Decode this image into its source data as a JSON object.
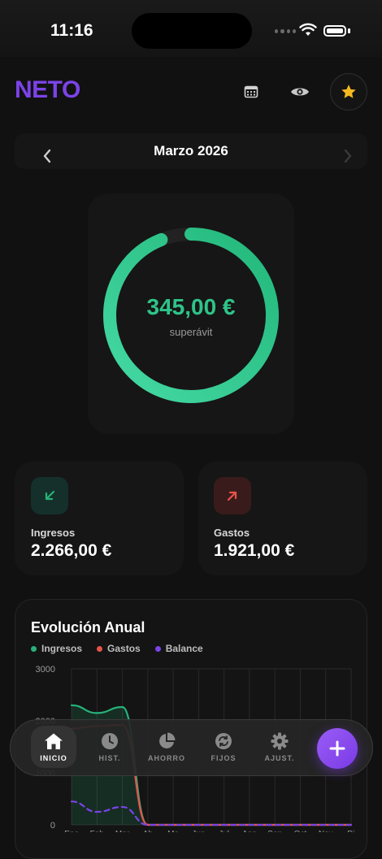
{
  "status_bar": {
    "time": "11:16"
  },
  "header": {
    "logo": "NETO",
    "icons": [
      "calendar-icon",
      "eye-icon",
      "star-icon"
    ],
    "star_color": "#f5b820"
  },
  "month_nav": {
    "label": "Marzo 2026"
  },
  "summary": {
    "amount": "345,00 €",
    "status": "superávit",
    "ring_fill": 0.94,
    "accent": "#2ec489"
  },
  "income": {
    "label": "Ingresos",
    "value": "2.266,00 €",
    "color": "#27b27a"
  },
  "expenses": {
    "label": "Gastos",
    "value": "1.921,00 €",
    "color": "#e5544b"
  },
  "chart_data": {
    "type": "line",
    "title": "Evolución Anual",
    "ylim": [
      0,
      3000
    ],
    "yticks": [
      "3000",
      "2000",
      "1000",
      "0"
    ],
    "x": [
      "Ene",
      "Feb",
      "Mar",
      "Abr",
      "May",
      "Jun",
      "Jul",
      "Ago",
      "Sep",
      "Oct",
      "Nov",
      "Dic"
    ],
    "x_visible": [
      "Ene",
      "Feb",
      "Mar",
      "Ab",
      "Ma",
      "Jun",
      "Jul",
      "Ago",
      "Sep",
      "Oct",
      "Nov",
      "Di"
    ],
    "series": [
      {
        "name": "Ingresos",
        "color": "#27b27a",
        "values": [
          2300,
          2150,
          2266,
          0,
          0,
          0,
          0,
          0,
          0,
          0,
          0,
          0
        ]
      },
      {
        "name": "Gastos",
        "color": "#e5544b",
        "values": [
          1850,
          1900,
          1921,
          0,
          0,
          0,
          0,
          0,
          0,
          0,
          0,
          0
        ]
      },
      {
        "name": "Balance",
        "color": "#7b43e8",
        "values": [
          450,
          250,
          345,
          0,
          0,
          0,
          0,
          0,
          0,
          0,
          0,
          0
        ]
      }
    ],
    "legend": [
      "Ingresos",
      "Gastos",
      "Balance"
    ],
    "grid": true
  },
  "tabs": [
    {
      "label": "INICIO",
      "icon": "home-icon",
      "active": true
    },
    {
      "label": "HIST.",
      "icon": "clock-icon",
      "active": false
    },
    {
      "label": "AHORRO",
      "icon": "pie-chart-icon",
      "active": false
    },
    {
      "label": "FIJOS",
      "icon": "repeat-icon",
      "active": false
    },
    {
      "label": "AJUST.",
      "icon": "gear-icon",
      "active": false
    }
  ],
  "fab": {
    "icon": "plus-icon"
  }
}
